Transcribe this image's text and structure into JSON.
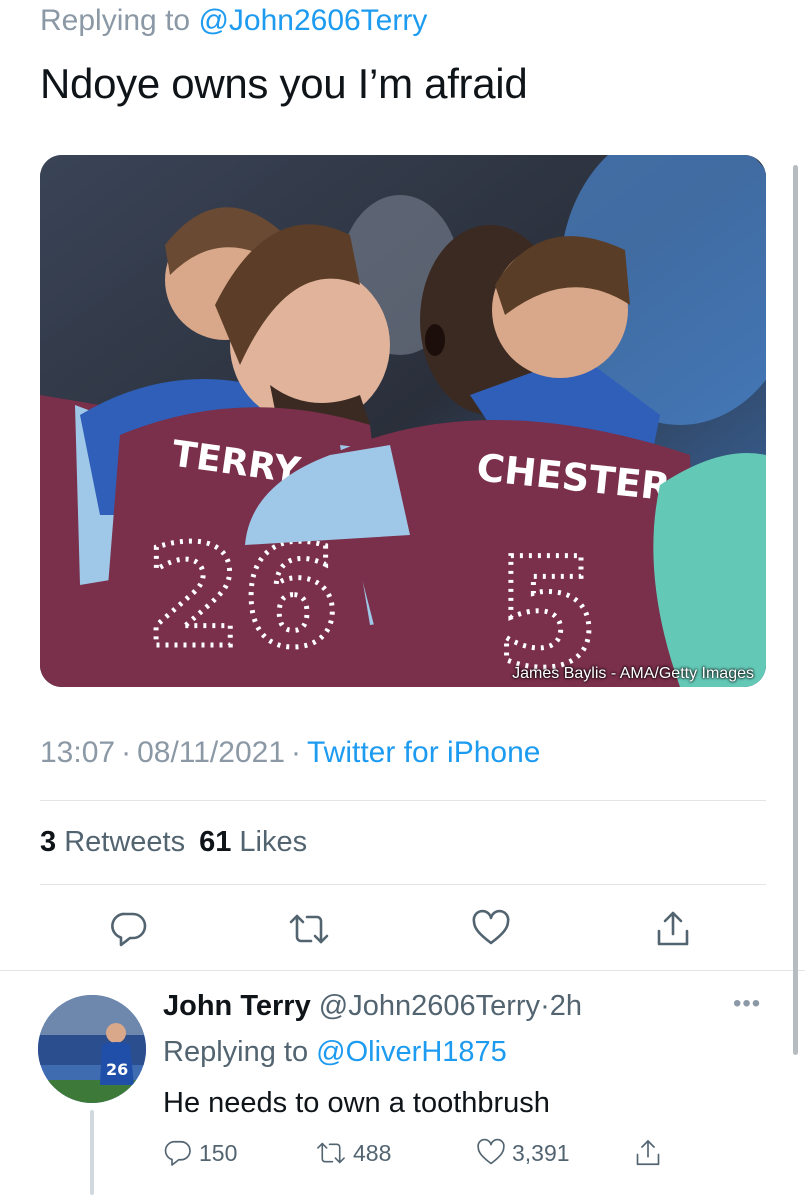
{
  "main_tweet": {
    "replying_prefix": "Replying to",
    "replying_handle": "@John2606Terry",
    "text": "Ndoye owns you I’m afraid",
    "photo": {
      "jersey_names": [
        "TERRY",
        "CHESTER"
      ],
      "jersey_numbers": [
        "26",
        "5"
      ],
      "credit": "James Baylis - AMA/Getty Images"
    },
    "time": "13:07",
    "date": "08/11/2021",
    "source": "Twitter for iPhone",
    "retweets_count": "3",
    "retweets_label": "Retweets",
    "likes_count": "61",
    "likes_label": "Likes"
  },
  "actions": [
    "reply-icon",
    "retweet-icon",
    "like-icon",
    "share-icon"
  ],
  "reply": {
    "name": "John Terry",
    "handle": "@John2606Terry",
    "time": "2h",
    "replying_prefix": "Replying to",
    "replying_handle": "@OliverH1875",
    "text": "He needs to own a toothbrush",
    "avatar_number": "26",
    "replies": "150",
    "retweets": "488",
    "likes": "3,391",
    "more": "•••"
  },
  "colors": {
    "link": "#1d9bf0",
    "muted": "#536471",
    "claret": "#7a2f4a",
    "sky": "#9ec7e8"
  }
}
